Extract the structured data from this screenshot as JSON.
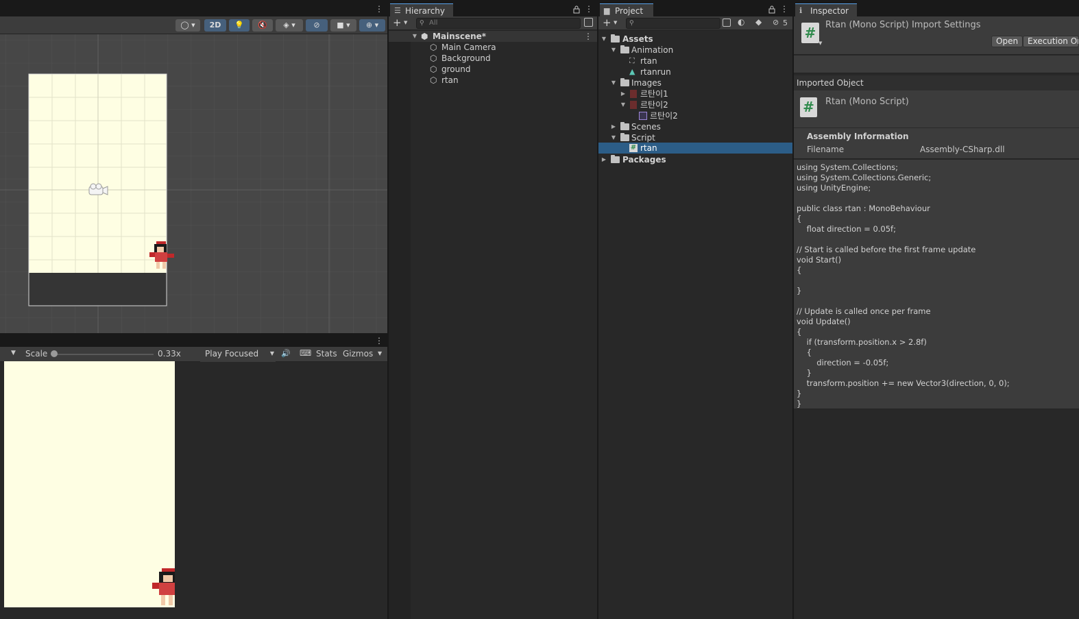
{
  "scene": {
    "toolbar": {
      "mode_2d": "2D"
    }
  },
  "game": {
    "scale_label": "Scale",
    "scale_value": "0.33x",
    "play_mode": "Play Focused",
    "stats": "Stats",
    "gizmos": "Gizmos"
  },
  "hierarchy": {
    "tab": "Hierarchy",
    "search_placeholder": "All",
    "scene_name": "Mainscene*",
    "items": [
      "Main Camera",
      "Background",
      "ground",
      "rtan"
    ]
  },
  "project": {
    "tab": "Project",
    "hidden_count": "5",
    "tree": {
      "assets": "Assets",
      "animation": "Animation",
      "anim_items": [
        "rtan",
        "rtanrun"
      ],
      "images": "Images",
      "image_items": [
        "르탄이1",
        "르탄이2"
      ],
      "image_sub": "르탄이2",
      "scenes": "Scenes",
      "script": "Script",
      "script_item": "rtan",
      "packages": "Packages"
    }
  },
  "inspector": {
    "tab": "Inspector",
    "title": "Rtan (Mono Script) Import Settings",
    "open_button": "Open",
    "execution_button": "Execution Or",
    "imported_object": "Imported Object",
    "object_name": "Rtan (Mono Script)",
    "assembly_info": "Assembly Information",
    "filename_label": "Filename",
    "filename_value": "Assembly-CSharp.dll",
    "code": "using System.Collections;\nusing System.Collections.Generic;\nusing UnityEngine;\n\npublic class rtan : MonoBehaviour\n{\n    float direction = 0.05f;\n\n// Start is called before the first frame update\nvoid Start()\n{\n\n}\n\n// Update is called once per frame\nvoid Update()\n{\n    if (transform.position.x > 2.8f)\n    {\n        direction = -0.05f;\n    }\n    transform.position += new Vector3(direction, 0, 0);\n}\n}"
  },
  "colors": {
    "selection": "#2c5d87",
    "accent_tab": "#58a0e8",
    "scene_bg": "#474747",
    "camera_bg": "#fefee3",
    "ground": "#353535",
    "script_hash": "#2f8a4c"
  }
}
